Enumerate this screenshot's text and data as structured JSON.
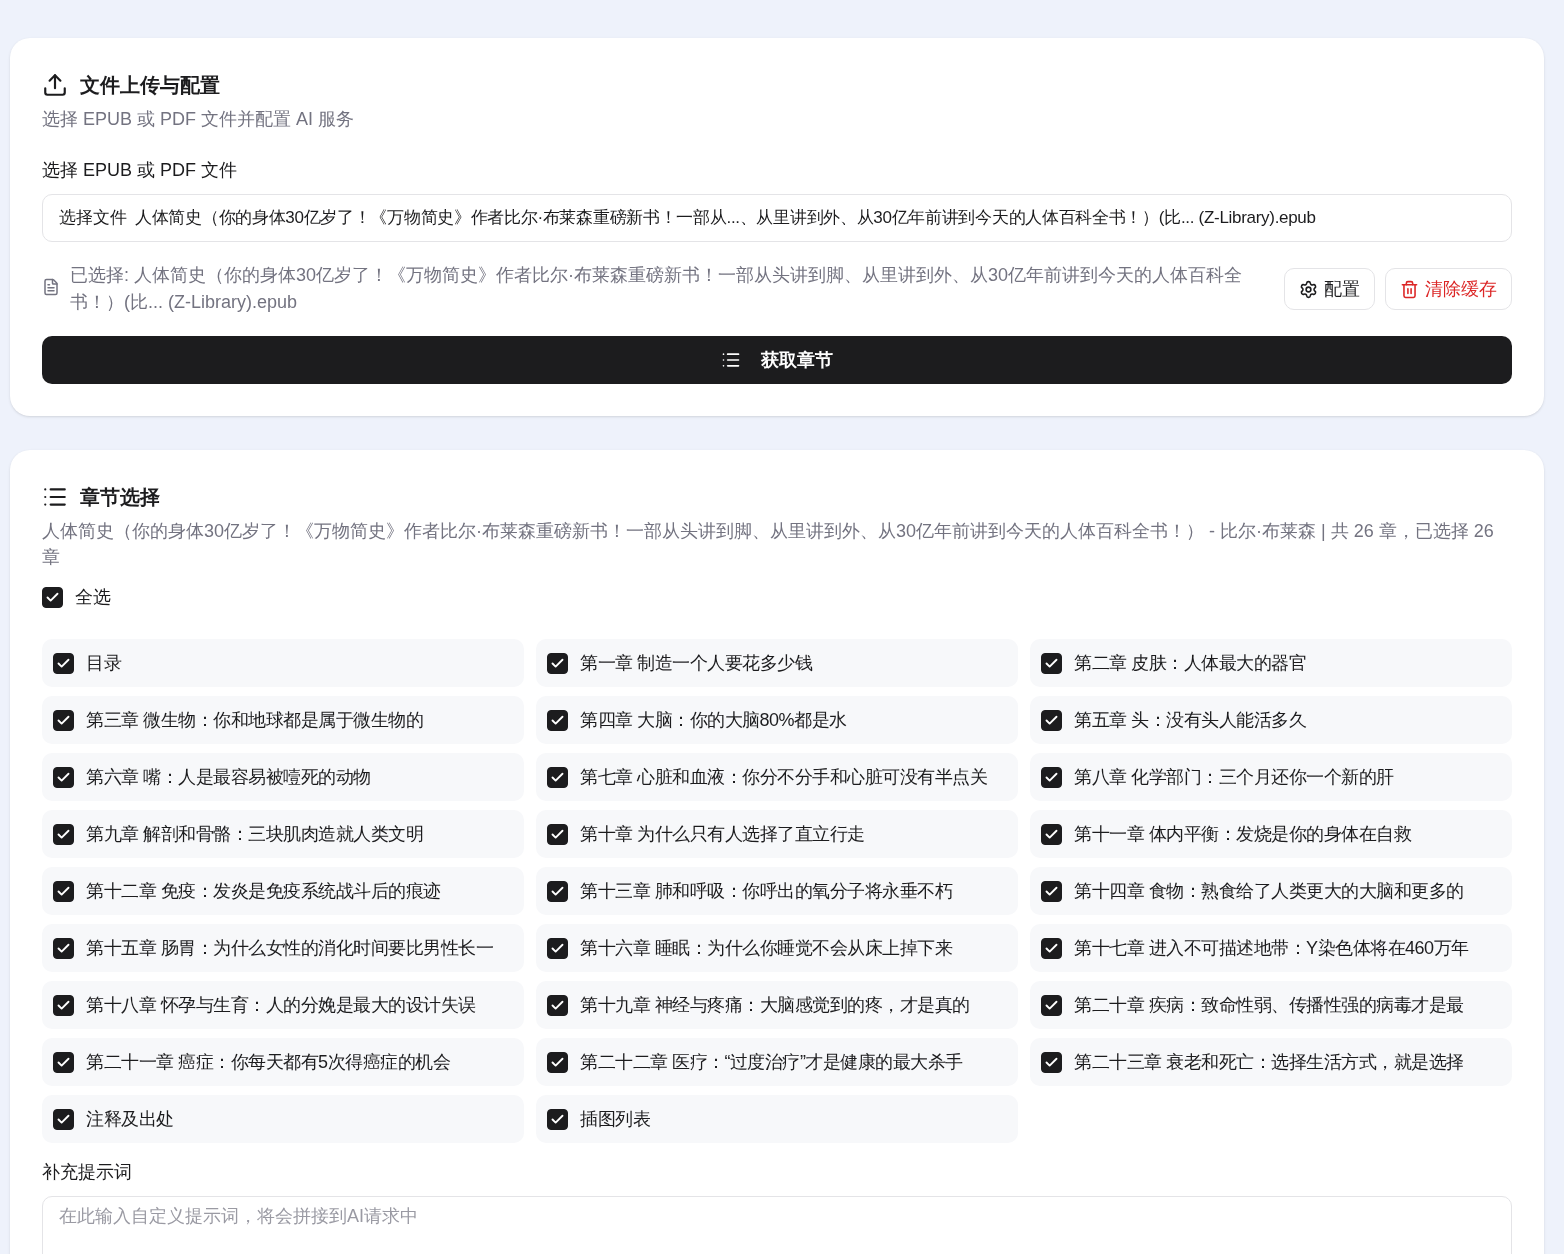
{
  "upload_card": {
    "title": "文件上传与配置",
    "subtitle": "选择 EPUB 或 PDF 文件并配置 AI 服务",
    "file_label": "选择 EPUB 或 PDF 文件",
    "file_button": "选择文件",
    "file_name": "人体简史（你的身体30亿岁了！《万物简史》作者比尔·布莱森重磅新书！一部从...、从里讲到外、从30亿年前讲到今天的人体百科全书！）(比... (Z-Library).epub",
    "selected_info": "已选择: 人体简史（你的身体30亿岁了！《万物简史》作者比尔·布莱森重磅新书！一部从头讲到脚、从里讲到外、从30亿年前讲到今天的人体百科全书！）(比... (Z-Library).epub",
    "config_button": "配置",
    "clear_button": "清除缓存",
    "fetch_button": "获取章节"
  },
  "chapter_card": {
    "title": "章节选择",
    "summary": "人体简史（你的身体30亿岁了！《万物简史》作者比尔·布莱森重磅新书！一部从头讲到脚、从里讲到外、从30亿年前讲到今天的人体百科全书！） - 比尔·布莱森 | 共 26 章，已选择 26 章",
    "select_all": {
      "label": "全选",
      "checked": true
    },
    "chapters": [
      {
        "label": "目录",
        "checked": true
      },
      {
        "label": "第一章 制造一个人要花多少钱",
        "checked": true
      },
      {
        "label": "第二章 皮肤：人体最大的器官",
        "checked": true
      },
      {
        "label": "第三章 微生物：你和地球都是属于微生物的",
        "checked": true
      },
      {
        "label": "第四章 大脑：你的大脑80%都是水",
        "checked": true
      },
      {
        "label": "第五章 头：没有头人能活多久",
        "checked": true
      },
      {
        "label": "第六章 嘴：人是最容易被噎死的动物",
        "checked": true
      },
      {
        "label": "第七章 心脏和血液：你分不分手和心脏可没有半点关",
        "checked": true
      },
      {
        "label": "第八章 化学部门：三个月还你一个新的肝",
        "checked": true
      },
      {
        "label": "第九章 解剖和骨骼：三块肌肉造就人类文明",
        "checked": true
      },
      {
        "label": "第十章 为什么只有人选择了直立行走",
        "checked": true
      },
      {
        "label": "第十一章 体内平衡：发烧是你的身体在自救",
        "checked": true
      },
      {
        "label": "第十二章 免疫：发炎是免疫系统战斗后的痕迹",
        "checked": true
      },
      {
        "label": "第十三章 肺和呼吸：你呼出的氧分子将永垂不朽",
        "checked": true
      },
      {
        "label": "第十四章 食物：熟食给了人类更大的大脑和更多的",
        "checked": true
      },
      {
        "label": "第十五章 肠胃：为什么女性的消化时间要比男性长一",
        "checked": true
      },
      {
        "label": "第十六章 睡眠：为什么你睡觉不会从床上掉下来",
        "checked": true
      },
      {
        "label": "第十七章 进入不可描述地带：Y染色体将在460万年",
        "checked": true
      },
      {
        "label": "第十八章 怀孕与生育：人的分娩是最大的设计失误",
        "checked": true
      },
      {
        "label": "第十九章 神经与疼痛：大脑感觉到的疼，才是真的",
        "checked": true
      },
      {
        "label": "第二十章 疾病：致命性弱、传播性强的病毒才是最",
        "checked": true
      },
      {
        "label": "第二十一章 癌症：你每天都有5次得癌症的机会",
        "checked": true
      },
      {
        "label": "第二十二章 医疗：“过度治疗”才是健康的最大杀手",
        "checked": true
      },
      {
        "label": "第二十三章 衰老和死亡：选择生活方式，就是选择",
        "checked": true
      },
      {
        "label": "注释及出处",
        "checked": true
      },
      {
        "label": "插图列表",
        "checked": true
      }
    ],
    "prompt_label": "补充提示词",
    "prompt_placeholder": "在此输入自定义提示词，将会拼接到AI请求中"
  }
}
